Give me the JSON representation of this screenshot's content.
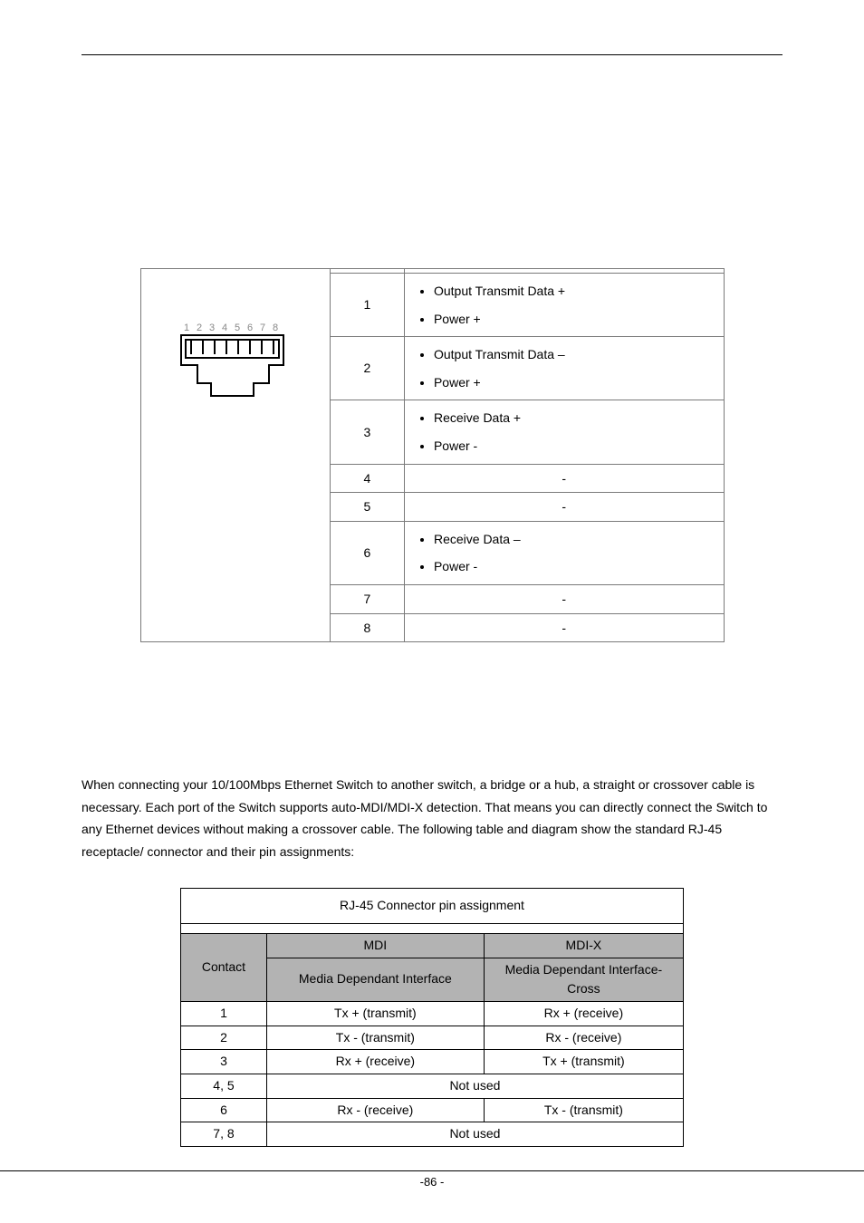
{
  "rj45_numbers": "1 2 3 4 5 6 7 8",
  "table1": {
    "rows": [
      {
        "pin": "1",
        "type": "list",
        "items": [
          "Output Transmit Data +",
          "Power +"
        ]
      },
      {
        "pin": "2",
        "type": "list",
        "items": [
          "Output Transmit Data –",
          "Power +"
        ]
      },
      {
        "pin": "3",
        "type": "list",
        "items": [
          "Receive Data +",
          "Power -"
        ]
      },
      {
        "pin": "4",
        "type": "dash"
      },
      {
        "pin": "5",
        "type": "dash"
      },
      {
        "pin": "6",
        "type": "list",
        "items": [
          "Receive Data –",
          "Power -"
        ]
      },
      {
        "pin": "7",
        "type": "dash"
      },
      {
        "pin": "8",
        "type": "dash"
      }
    ]
  },
  "paragraph": "When connecting your 10/100Mbps Ethernet Switch to another switch, a bridge or a hub, a straight or crossover cable is necessary. Each port of the Switch supports auto-MDI/MDI-X detection. That means you can directly connect the Switch to any Ethernet devices without making a crossover cable. The following table and diagram show the standard RJ-45 receptacle/ connector and their pin assignments:",
  "table2": {
    "title": "RJ-45 Connector pin assignment",
    "headers": {
      "contact": "Contact",
      "mdi_top": "MDI",
      "mdi_bottom": "Media Dependant Interface",
      "mdix_top": "MDI-X",
      "mdix_bottom": "Media Dependant Interface-Cross"
    },
    "rows": [
      {
        "contact": "1",
        "mdi": "Tx + (transmit)",
        "mdix": "Rx + (receive)"
      },
      {
        "contact": "2",
        "mdi": "Tx - (transmit)",
        "mdix": "Rx - (receive)"
      },
      {
        "contact": "3",
        "mdi": "Rx + (receive)",
        "mdix": "Tx + (transmit)"
      },
      {
        "contact": "4, 5",
        "span": "Not used"
      },
      {
        "contact": "6",
        "mdi": "Rx - (receive)",
        "mdix": "Tx - (transmit)"
      },
      {
        "contact": "7, 8",
        "span": "Not used"
      }
    ]
  },
  "page_number": "-86 -"
}
